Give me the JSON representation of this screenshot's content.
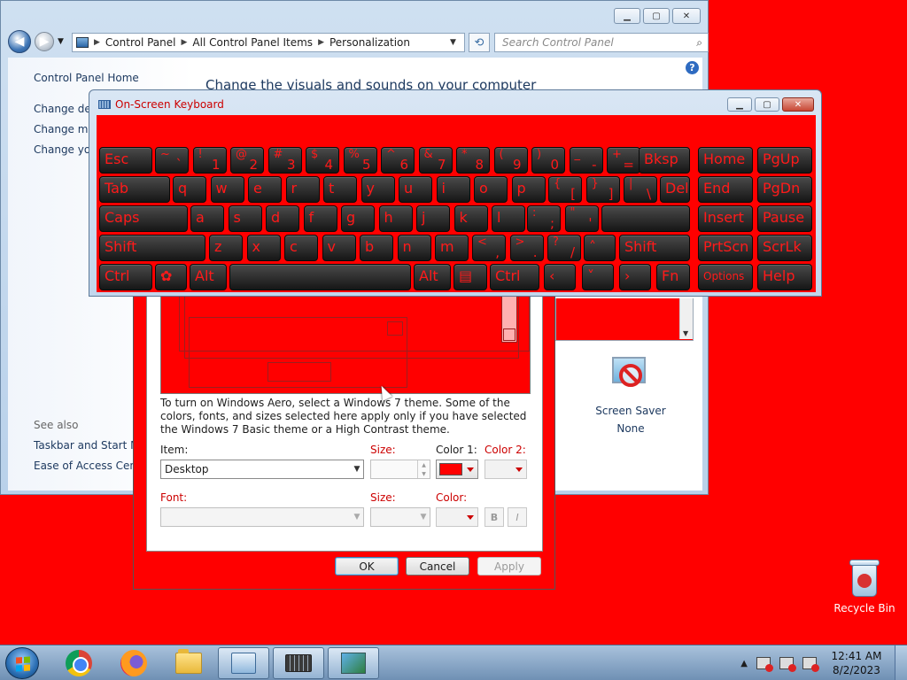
{
  "desktop": {
    "recycle_bin_label": "Recycle Bin"
  },
  "control_panel": {
    "breadcrumb": [
      "Control Panel",
      "All Control Panel Items",
      "Personalization"
    ],
    "search_placeholder": "Search Control Panel",
    "sidebar": {
      "home": "Control Panel Home",
      "links": [
        "Change des",
        "Change mo",
        "Change you"
      ],
      "see_also_heading": "See also",
      "see_also": [
        "Taskbar and Start Men",
        "Ease of Access Center"
      ]
    },
    "heading": "Change the visuals and sounds on your computer",
    "screen_saver": {
      "label": "Screen Saver",
      "value": "None"
    }
  },
  "appearance_dialog": {
    "info_text": "To turn on Windows Aero, select a Windows 7 theme.  Some of the colors, fonts, and sizes selected here apply only if you have selected the Windows 7 Basic theme or a High Contrast theme.",
    "item_label": "Item:",
    "item_value": "Desktop",
    "size_label": "Size:",
    "color1_label": "Color 1:",
    "color2_label": "Color 2:",
    "font_label": "Font:",
    "font_size_label": "Size:",
    "font_color_label": "Color:",
    "bold_label": "B",
    "italic_label": "I",
    "buttons": {
      "ok": "OK",
      "cancel": "Cancel",
      "apply": "Apply"
    },
    "color1": "#ff0000"
  },
  "osk": {
    "title": "On-Screen Keyboard",
    "keys": {
      "esc": "Esc",
      "tab": "Tab",
      "caps": "Caps",
      "shift_l": "Shift",
      "shift_r": "Shift",
      "ctrl_l": "Ctrl",
      "ctrl_r": "Ctrl",
      "alt_l": "Alt",
      "alt_r": "Alt",
      "bksp": "Bksp",
      "del": "Del",
      "home": "Home",
      "pgup": "PgUp",
      "end": "End",
      "pgdn": "PgDn",
      "insert": "Insert",
      "pause": "Pause",
      "prtscn": "PrtScn",
      "scrlk": "ScrLk",
      "options": "Options",
      "help": "Help",
      "fn": "Fn",
      "row1": [
        [
          "~",
          "`"
        ],
        [
          "!",
          "1"
        ],
        [
          "@",
          "2"
        ],
        [
          "#",
          "3"
        ],
        [
          "$",
          "4"
        ],
        [
          "%",
          "5"
        ],
        [
          "^",
          "6"
        ],
        [
          "&",
          "7"
        ],
        [
          "*",
          "8"
        ],
        [
          "(",
          "9"
        ],
        [
          ")",
          "0"
        ],
        [
          "_",
          "-"
        ],
        [
          "+",
          "="
        ]
      ],
      "row2": [
        "q",
        "w",
        "e",
        "r",
        "t",
        "y",
        "u",
        "i",
        "o",
        "p"
      ],
      "row2_sym": [
        [
          "{",
          "["
        ],
        [
          "}",
          "]"
        ],
        [
          "|",
          "\\"
        ]
      ],
      "row3": [
        "a",
        "s",
        "d",
        "f",
        "g",
        "h",
        "j",
        "k",
        "l"
      ],
      "row3_sym": [
        [
          ":",
          ";"
        ],
        [
          "\"",
          "'"
        ]
      ],
      "row4": [
        "z",
        "x",
        "c",
        "v",
        "b",
        "n",
        "m"
      ],
      "row4_sym": [
        [
          "<",
          ","
        ],
        [
          ">",
          "."
        ],
        [
          "?",
          "/"
        ]
      ],
      "arrows": [
        "‹",
        "˄",
        "˅",
        "›"
      ]
    }
  },
  "taskbar": {
    "time": "12:41 AM",
    "date": "8/2/2023"
  },
  "colors": {
    "desktop_bg": "#ff0000",
    "key_label": "#ff1a1a"
  }
}
